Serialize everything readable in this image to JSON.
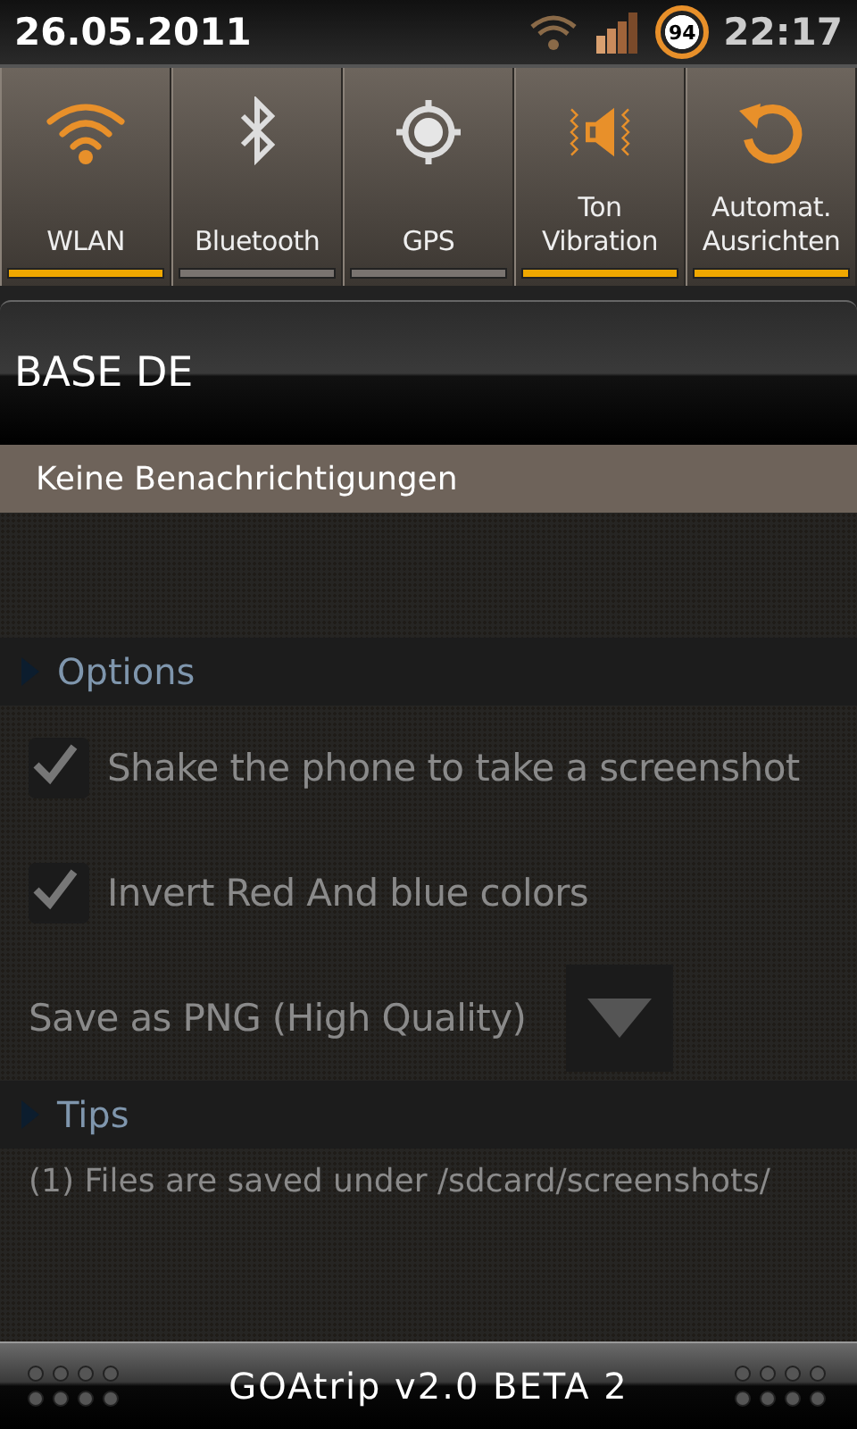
{
  "status_bar": {
    "date": "26.05.2011",
    "battery": "94",
    "time": "22:17"
  },
  "toggles": [
    {
      "kind": "wifi",
      "label": "WLAN",
      "on": true
    },
    {
      "kind": "bluetooth",
      "label": "Bluetooth",
      "on": false
    },
    {
      "kind": "gps",
      "label": "GPS",
      "on": false
    },
    {
      "kind": "sound",
      "label": "Ton\nVibration",
      "on": true
    },
    {
      "kind": "rotate",
      "label": "Automat.\nAusrichten",
      "on": true
    }
  ],
  "carrier": "BASE DE",
  "notifications": {
    "empty_message": "Keine Benachrichtigungen"
  },
  "background_app": {
    "sections": [
      {
        "title": "Options",
        "items": [
          {
            "kind": "checkbox",
            "label": "Shake the phone to take a screenshot",
            "checked": true
          },
          {
            "kind": "checkbox",
            "label": "Invert Red And blue colors",
            "checked": true
          },
          {
            "kind": "dropdown",
            "label": "Save as PNG (High Quality)"
          }
        ]
      },
      {
        "title": "Tips",
        "items": [
          {
            "kind": "text",
            "label": "(1) Files are saved under /sdcard/screenshots/"
          }
        ]
      }
    ],
    "footer": "GOAtrip v2.0 BETA 2"
  }
}
